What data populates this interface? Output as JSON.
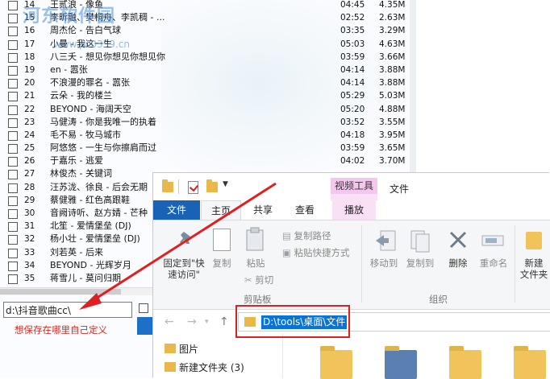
{
  "songs": [
    {
      "num": "14",
      "title": "王贰浪 - 像鱼",
      "dur": "04:45",
      "size": "4.35M"
    },
    {
      "num": "15",
      "title": "李昕融、樊桐舟、李凯稠 - ...",
      "dur": "02:52",
      "size": "2.63M"
    },
    {
      "num": "16",
      "title": "周杰伦 - 告白气球",
      "dur": "03:35",
      "size": "3.29M"
    },
    {
      "num": "17",
      "title": "小曼 - 我这一生",
      "dur": "05:03",
      "size": "4.63M"
    },
    {
      "num": "18",
      "title": "八三夭 - 想见你想见你想见你",
      "dur": "03:59",
      "size": "3.66M"
    },
    {
      "num": "19",
      "title": "en - 嚣张",
      "dur": "04:14",
      "size": "3.88M"
    },
    {
      "num": "20",
      "title": "不浪漫的罪名 - 嚣张",
      "dur": "04:14",
      "size": "3.88M"
    },
    {
      "num": "21",
      "title": "云朵 - 我的楼兰",
      "dur": "05:29",
      "size": "5.03M"
    },
    {
      "num": "22",
      "title": "BEYOND - 海阔天空",
      "dur": "05:20",
      "size": "4.88M"
    },
    {
      "num": "23",
      "title": "马健涛 - 你是我唯一的执着",
      "dur": "03:52",
      "size": "3.55M"
    },
    {
      "num": "24",
      "title": "毛不易 - 牧马城市",
      "dur": "04:18",
      "size": "3.95M"
    },
    {
      "num": "25",
      "title": "阿悠悠 - 一生与你擦肩而过",
      "dur": "03:59",
      "size": "3.65M"
    },
    {
      "num": "26",
      "title": "于嘉乐 - 逃爱",
      "dur": "04:02",
      "size": "3.70M"
    },
    {
      "num": "27",
      "title": "林俊杰 - 关键词",
      "dur": "",
      "size": ""
    },
    {
      "num": "28",
      "title": "汪苏泷、徐良 - 后会无期",
      "dur": "",
      "size": ""
    },
    {
      "num": "29",
      "title": "蔡健雅 - 红色高跟鞋",
      "dur": "",
      "size": ""
    },
    {
      "num": "30",
      "title": "音阙诗听、赵方婧 - 芒种",
      "dur": "",
      "size": ""
    },
    {
      "num": "31",
      "title": "北笙 - 爱情堡垒 (DJ)",
      "dur": "",
      "size": ""
    },
    {
      "num": "32",
      "title": "杨小壮 - 爱情堡垒 (DJ)",
      "dur": "",
      "size": ""
    },
    {
      "num": "33",
      "title": "刘若英 - 后来",
      "dur": "",
      "size": ""
    },
    {
      "num": "34",
      "title": "BEYOND - 光辉岁月",
      "dur": "",
      "size": ""
    },
    {
      "num": "35",
      "title": "蒋雪儿 - 莫问归期",
      "dur": "",
      "size": ""
    }
  ],
  "watermark": {
    "text": "河东软件园",
    "url": "www.pc0359.cn"
  },
  "save_path": "d:\\抖音歌曲cc\\",
  "save_note": "想保存在哪里自己定义",
  "explorer": {
    "context_tab": "视频工具",
    "title": "文件",
    "tabs": {
      "file": "文件",
      "home": "主页",
      "share": "共享",
      "view": "查看",
      "play": "播放"
    },
    "ribbon": {
      "pin": "固定到\"快\n速访问\"",
      "copy": "复制",
      "paste": "粘贴",
      "copy_path": "复制路径",
      "paste_shortcut": "粘贴快捷方式",
      "cut": "剪切",
      "clipboard_group": "剪贴板",
      "move_to": "移动到",
      "copy_to": "复制到",
      "delete": "删除",
      "rename": "重命名",
      "organize_group": "组织",
      "new_folder": "新建\n文件夹"
    },
    "address": "D:\\tools\\桌面\\文件",
    "nav": [
      {
        "label": "图片"
      },
      {
        "label": "新建文件夹 (3)"
      }
    ]
  }
}
